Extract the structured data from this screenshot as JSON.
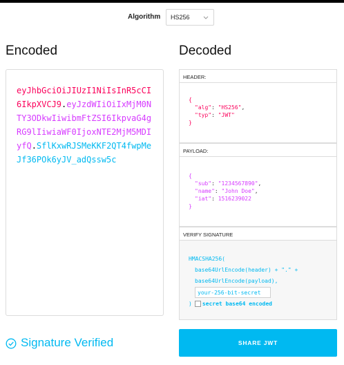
{
  "algorithm": {
    "label": "Algorithm",
    "selected": "HS256"
  },
  "encoded": {
    "title": "Encoded",
    "header_part": "eyJhbGciOiJIUzI1NiIsInR5cCI6IkpXVCJ9",
    "dot": ".",
    "payload_part": "eyJzdWIiOiIxMjM0NTY3ODkwIiwibmFtZSI6IkpvaG4gRG9lIiwiaWF0IjoxNTE2MjM5MDIyfQ",
    "signature_part": "SflKxwRJSMeKKF2QT4fwpMeJf36POk6yJV_adQssw5c"
  },
  "decoded": {
    "title": "Decoded",
    "header": {
      "label": "HEADER:",
      "open": "{",
      "close": "}",
      "alg_key": "\"alg\"",
      "alg_val": "\"HS256\"",
      "typ_key": "\"typ\"",
      "typ_val": "\"JWT\""
    },
    "payload": {
      "label": "PAYLOAD:",
      "open": "{",
      "close": "}",
      "sub_key": "\"sub\"",
      "sub_val": "\"1234567890\"",
      "name_key": "\"name\"",
      "name_val": "\"John Doe\"",
      "iat_key": "\"iat\"",
      "iat_val": "1516239022"
    },
    "verify": {
      "label": "VERIFY SIGNATURE",
      "line1": "HMACSHA256(",
      "line2": "base64UrlEncode(header) + \".\" +",
      "line3": "base64UrlEncode(payload),",
      "secret_placeholder": "your-256-bit-secret",
      "close": ")",
      "b64_label": "secret base64 encoded"
    }
  },
  "status": {
    "text": "Signature Verified"
  },
  "share_button": "SHARE JWT",
  "colors": {
    "header": "#fb015b",
    "payload": "#d63aff",
    "signature": "#00b9f1"
  }
}
